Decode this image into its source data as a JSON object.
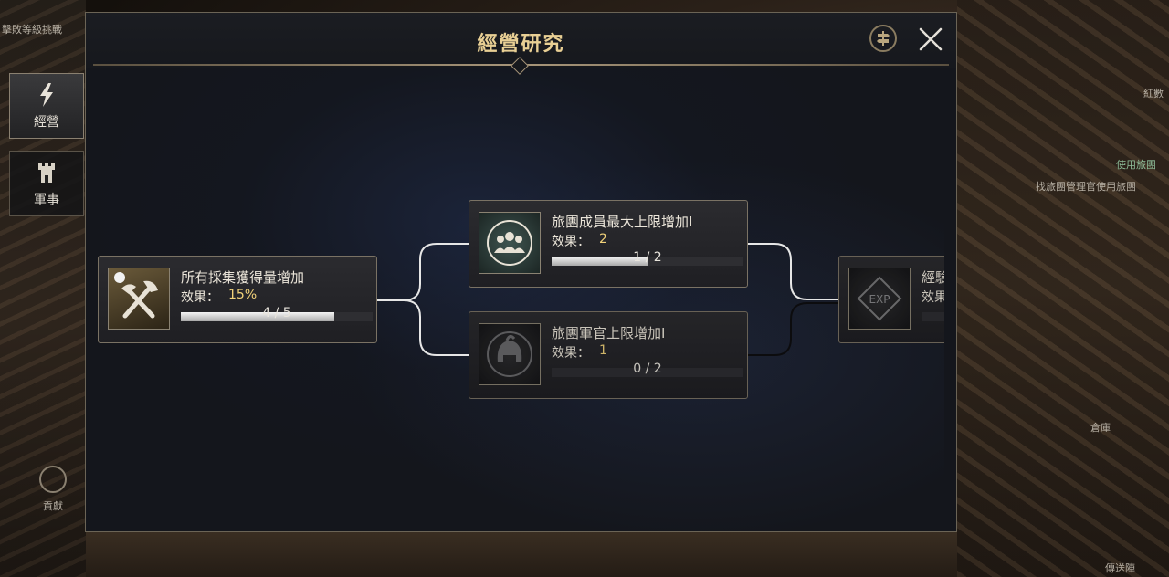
{
  "panel": {
    "title": "經營研究"
  },
  "side_tabs": [
    {
      "label": "經營",
      "active": true
    },
    {
      "label": "軍事",
      "active": false
    }
  ],
  "nodes": [
    {
      "name": "所有採集獲得量增加",
      "effect_label": "效果：",
      "effect_value": "15%",
      "progress_text": "4 / 5",
      "progress": 0.8
    },
    {
      "name": "旅團成員最大上限增加I",
      "effect_label": "效果：",
      "effect_value": "2",
      "progress_text": "1 / 2",
      "progress": 0.5
    },
    {
      "name": "旅團軍官上限增加I",
      "effect_label": "效果：",
      "effect_value": "1",
      "progress_text": "0 / 2",
      "progress": 0.0
    },
    {
      "name": "經驗",
      "effect_label": "效果",
      "effect_value": "",
      "progress_text": "",
      "progress": 0.0
    }
  ],
  "world": {
    "top_left_text": "擊敗等級挑戰",
    "right_text_1": "使用旅團",
    "right_text_2": "找旅團管理官使用旅團",
    "warehouse": "倉庫",
    "contribution": "貢獻",
    "right_top": "紅數",
    "bottom_right": "傳送陣"
  },
  "icons": {
    "tab_business": "lightning-icon",
    "tab_military": "tower-icon",
    "node1": "axe-pickaxe-icon",
    "node2": "members-icon",
    "node3": "helmet-icon",
    "node4": "exp-icon",
    "header_sign": "signpost-icon",
    "close": "close-icon"
  },
  "colors": {
    "title": "#e8cf94",
    "effect_value": "#f1d27a"
  }
}
